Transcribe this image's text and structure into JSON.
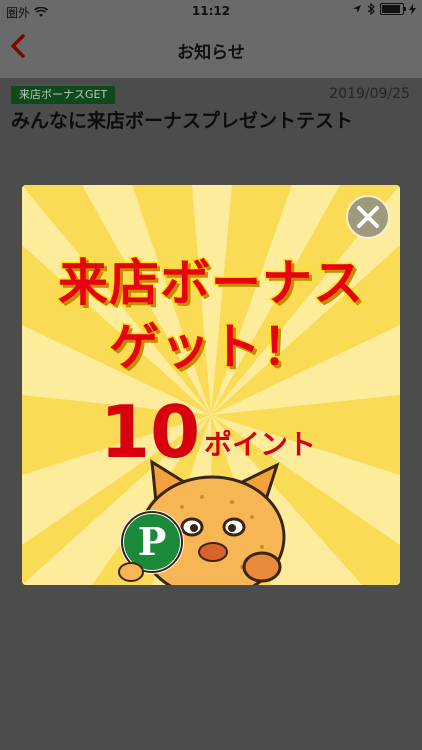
{
  "status_bar": {
    "carrier": "圏外",
    "time": "11:12",
    "icons": [
      "wifi-icon",
      "location-icon",
      "bluetooth-icon",
      "battery-icon"
    ]
  },
  "nav": {
    "back_icon": "chevron-left-icon",
    "title": "お知らせ"
  },
  "article": {
    "category_badge": "来店ボーナスGET",
    "date": "2019/09/25",
    "title": "みんなに来店ボーナスプレゼントテスト"
  },
  "popup": {
    "headline_line1": "来店ボーナス",
    "headline_line2": "ゲット！",
    "points_value": "10",
    "points_unit": "ポイント",
    "coin_letter": "P",
    "close_icon": "close-icon"
  },
  "colors": {
    "overlay": "#4c4c4c",
    "accent_red": "#e60012",
    "badge_green": "#0e4a1c",
    "popup_yellow": "#fbe680"
  }
}
